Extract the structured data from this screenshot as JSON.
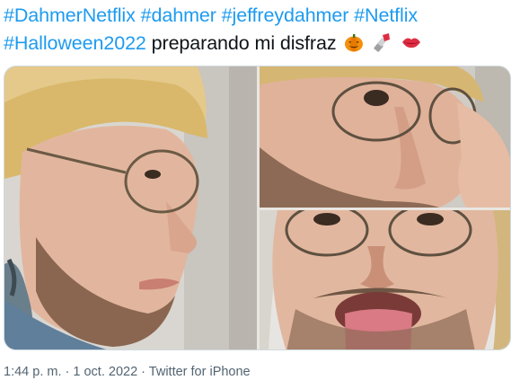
{
  "tweet": {
    "hashtags_line1": [
      "#DahmerNetflix",
      "#dahmer",
      "#jeffreydahmer",
      "#Netflix"
    ],
    "hashtag_line2": "#Halloween2022",
    "text": "preparando mi disfraz",
    "emojis": [
      "pumpkin-icon",
      "lipstick-icon",
      "lips-icon"
    ]
  },
  "meta": {
    "time": "1:44 p. m.",
    "separator": "·",
    "date": "1 oct. 2022",
    "source": "Twitter for iPhone"
  },
  "colors": {
    "hashtag": "#1d9bf0",
    "text": "#0f1419",
    "meta": "#536471",
    "border": "#cfd9de"
  }
}
